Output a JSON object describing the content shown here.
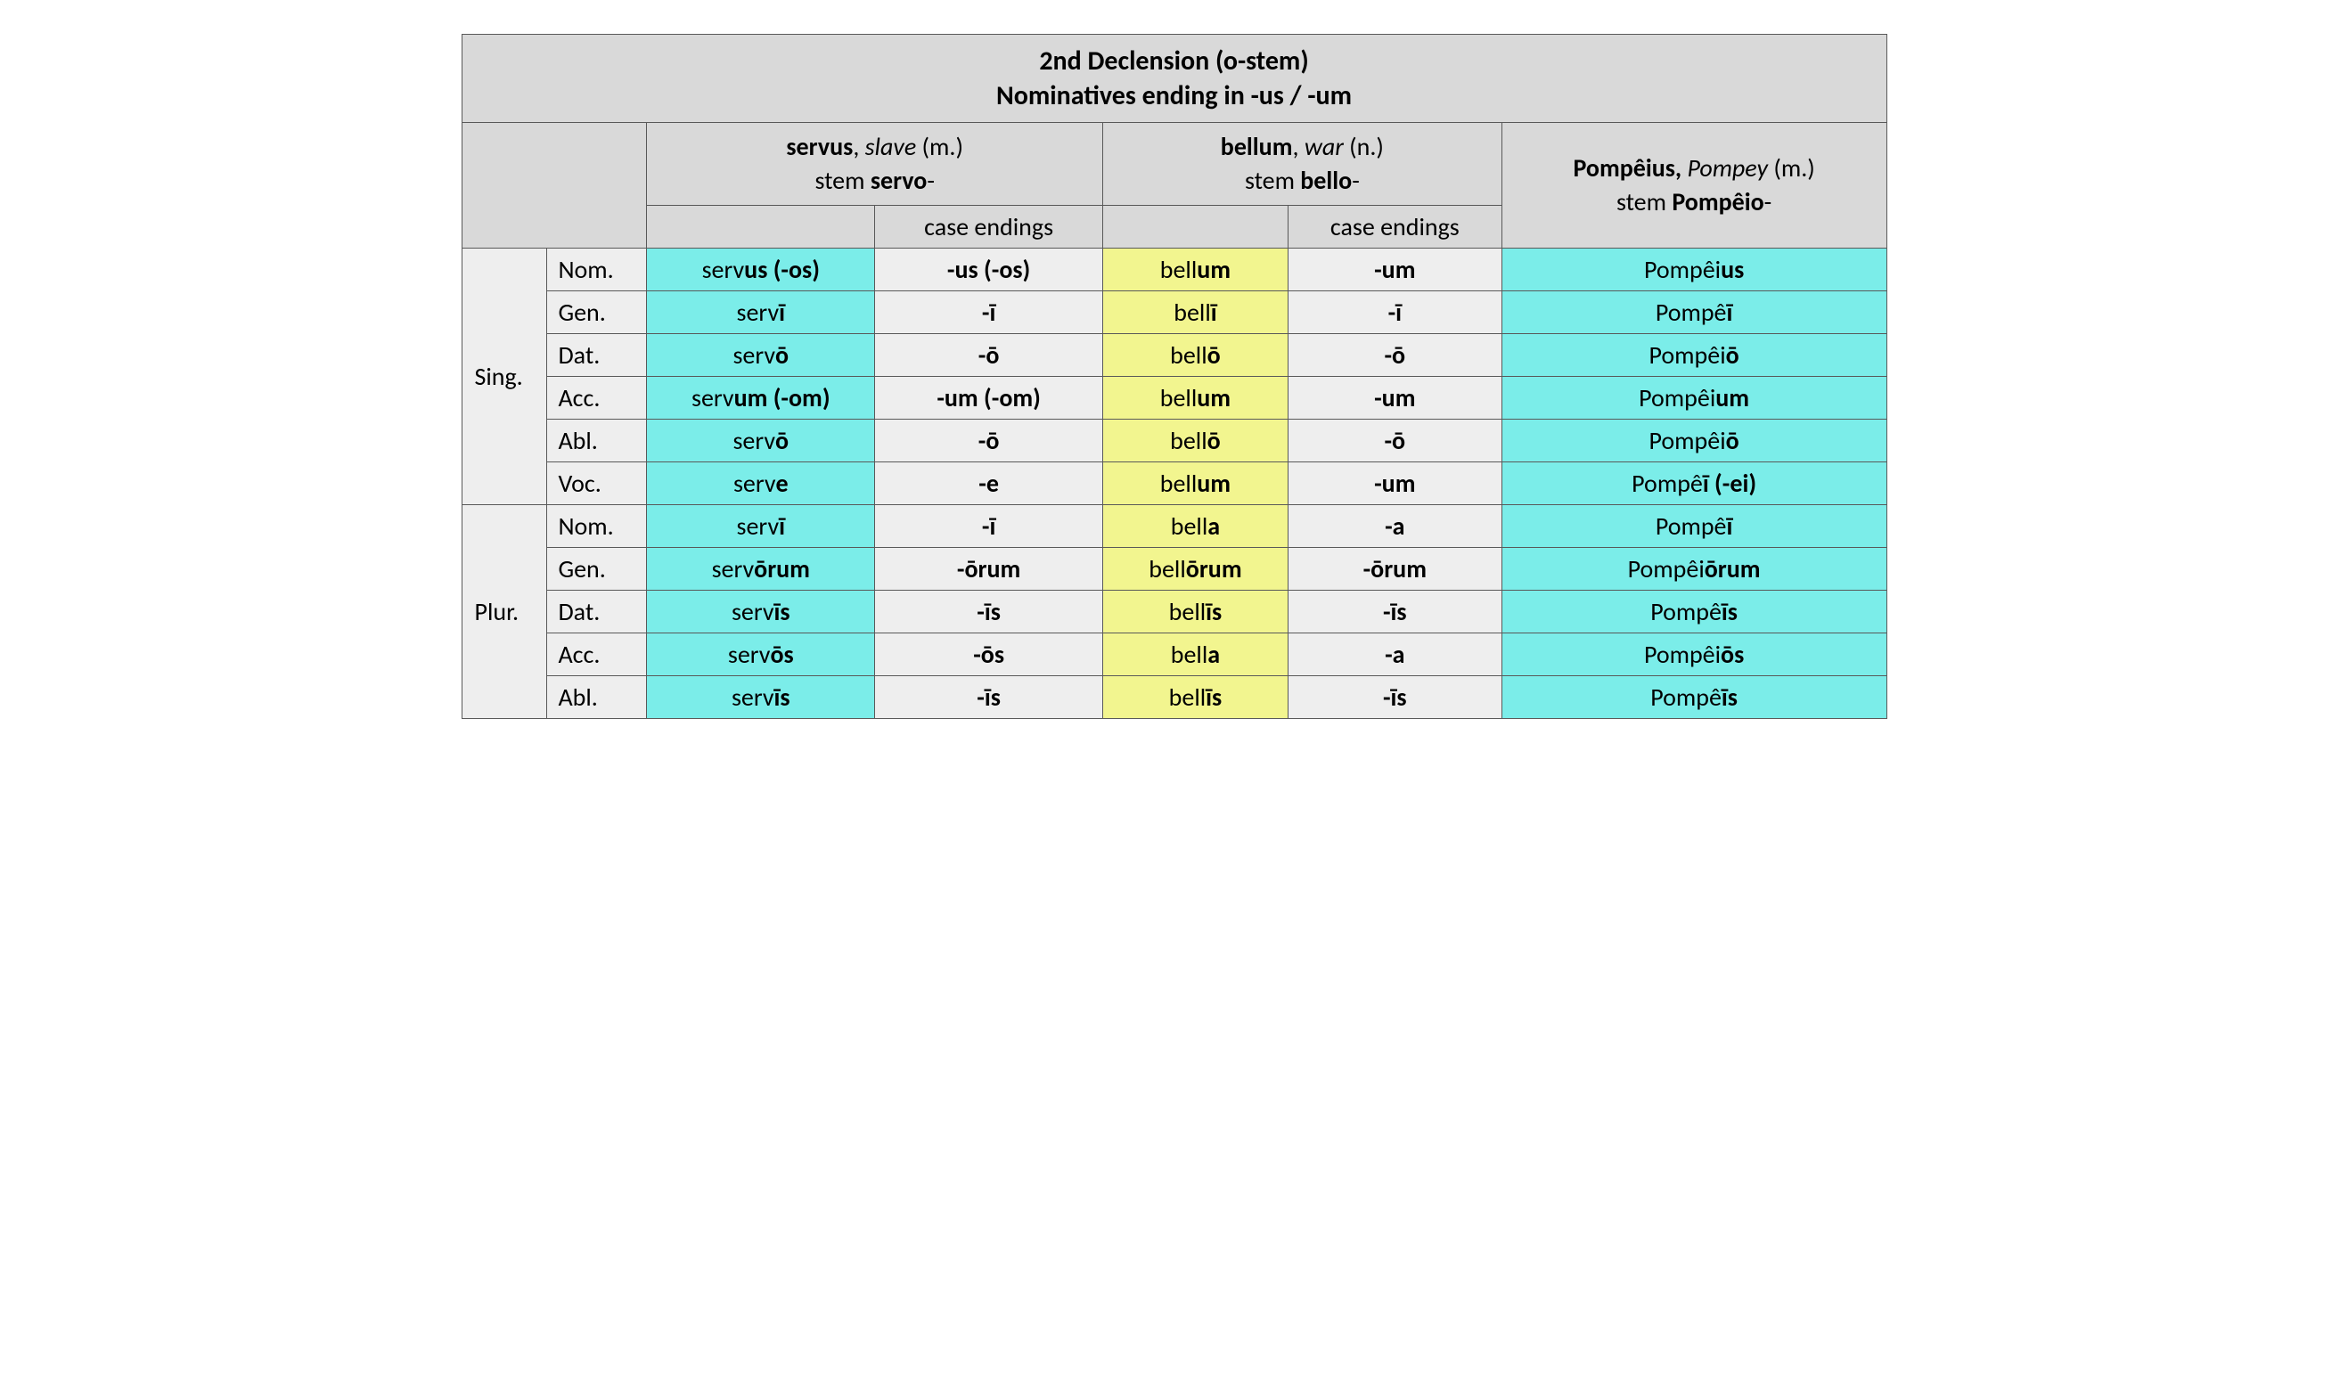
{
  "title_line1": "2nd Declension (o-stem)",
  "title_line2": "Nominatives ending in -us / -um",
  "headers": {
    "servus": {
      "word": "servus",
      "comma": ", ",
      "gloss": "slave",
      "gender": " (m.)",
      "stem_label": "stem ",
      "stem": "servo",
      "dash": "-"
    },
    "bellum": {
      "word": "bellum",
      "comma": ", ",
      "gloss": "war",
      "gender": " (n.)",
      "stem_label": "stem ",
      "stem": "bello",
      "dash": "-"
    },
    "pompeius": {
      "word": "Pompêius,",
      "space": " ",
      "gloss": "Pompey",
      "gender": " (m.)",
      "stem_label": "stem ",
      "stem": "Pompêio",
      "dash": "-"
    }
  },
  "case_endings_label": "case endings",
  "numbers": {
    "sing": "Sing.",
    "plur": "Plur."
  },
  "cases": {
    "nom": "Nom.",
    "gen": "Gen.",
    "dat": "Dat.",
    "acc": "Acc.",
    "abl": "Abl.",
    "voc": "Voc."
  },
  "rows": {
    "s_nom": {
      "servus_root": "serv",
      "servus_end": "us (-os)",
      "servus_ending": "-us (-os)",
      "bellum_root": "bell",
      "bellum_end": "um",
      "bellum_ending": "-um",
      "pompeius_root": "Pompêi",
      "pompeius_end": "us"
    },
    "s_gen": {
      "servus_root": "serv",
      "servus_end": "ī",
      "servus_ending": "-ī",
      "bellum_root": "bell",
      "bellum_end": "ī",
      "bellum_ending": "-ī",
      "pompeius_root": "Pompê",
      "pompeius_end": "ī"
    },
    "s_dat": {
      "servus_root": "serv",
      "servus_end": "ō",
      "servus_ending": "-ō",
      "bellum_root": "bell",
      "bellum_end": "ō",
      "bellum_ending": "-ō",
      "pompeius_root": "Pompêi",
      "pompeius_end": "ō"
    },
    "s_acc": {
      "servus_root": "serv",
      "servus_end": "um (-om)",
      "servus_ending": "-um (-om)",
      "bellum_root": "bell",
      "bellum_end": "um",
      "bellum_ending": "-um",
      "pompeius_root": "Pompêi",
      "pompeius_end": "um"
    },
    "s_abl": {
      "servus_root": "serv",
      "servus_end": "ō",
      "servus_ending": "-ō",
      "bellum_root": "bell",
      "bellum_end": "ō",
      "bellum_ending": "-ō",
      "pompeius_root": "Pompêi",
      "pompeius_end": "ō"
    },
    "s_voc": {
      "servus_root": "serv",
      "servus_end": "e",
      "servus_ending": "-e",
      "bellum_root": "bell",
      "bellum_end": "um",
      "bellum_ending": "-um",
      "pompeius_root": "Pompê",
      "pompeius_end": "ī (-ei)"
    },
    "p_nom": {
      "servus_root": "serv",
      "servus_end": "ī",
      "servus_ending": "-ī",
      "bellum_root": "bell",
      "bellum_end": "a",
      "bellum_ending": "-a",
      "pompeius_root": "Pompê",
      "pompeius_end": "ī"
    },
    "p_gen": {
      "servus_root": "serv",
      "servus_end": "ōrum",
      "servus_ending": "-ōrum",
      "bellum_root": "bell",
      "bellum_end": "ōrum",
      "bellum_ending": "-ōrum",
      "pompeius_root": "Pompêi",
      "pompeius_end": "ōrum"
    },
    "p_dat": {
      "servus_root": "serv",
      "servus_end": "īs",
      "servus_ending": "-īs",
      "bellum_root": "bell",
      "bellum_end": "īs",
      "bellum_ending": "-īs",
      "pompeius_root": "Pompê",
      "pompeius_end": "īs"
    },
    "p_acc": {
      "servus_root": "serv",
      "servus_end": "ōs",
      "servus_ending": "-ōs",
      "bellum_root": "bell",
      "bellum_end": "a",
      "bellum_ending": "-a",
      "pompeius_root": "Pompêi",
      "pompeius_end": "ōs"
    },
    "p_abl": {
      "servus_root": "serv",
      "servus_end": "īs",
      "servus_ending": "-īs",
      "bellum_root": "bell",
      "bellum_end": "īs",
      "bellum_ending": "-īs",
      "pompeius_root": "Pompê",
      "pompeius_end": "īs"
    }
  }
}
